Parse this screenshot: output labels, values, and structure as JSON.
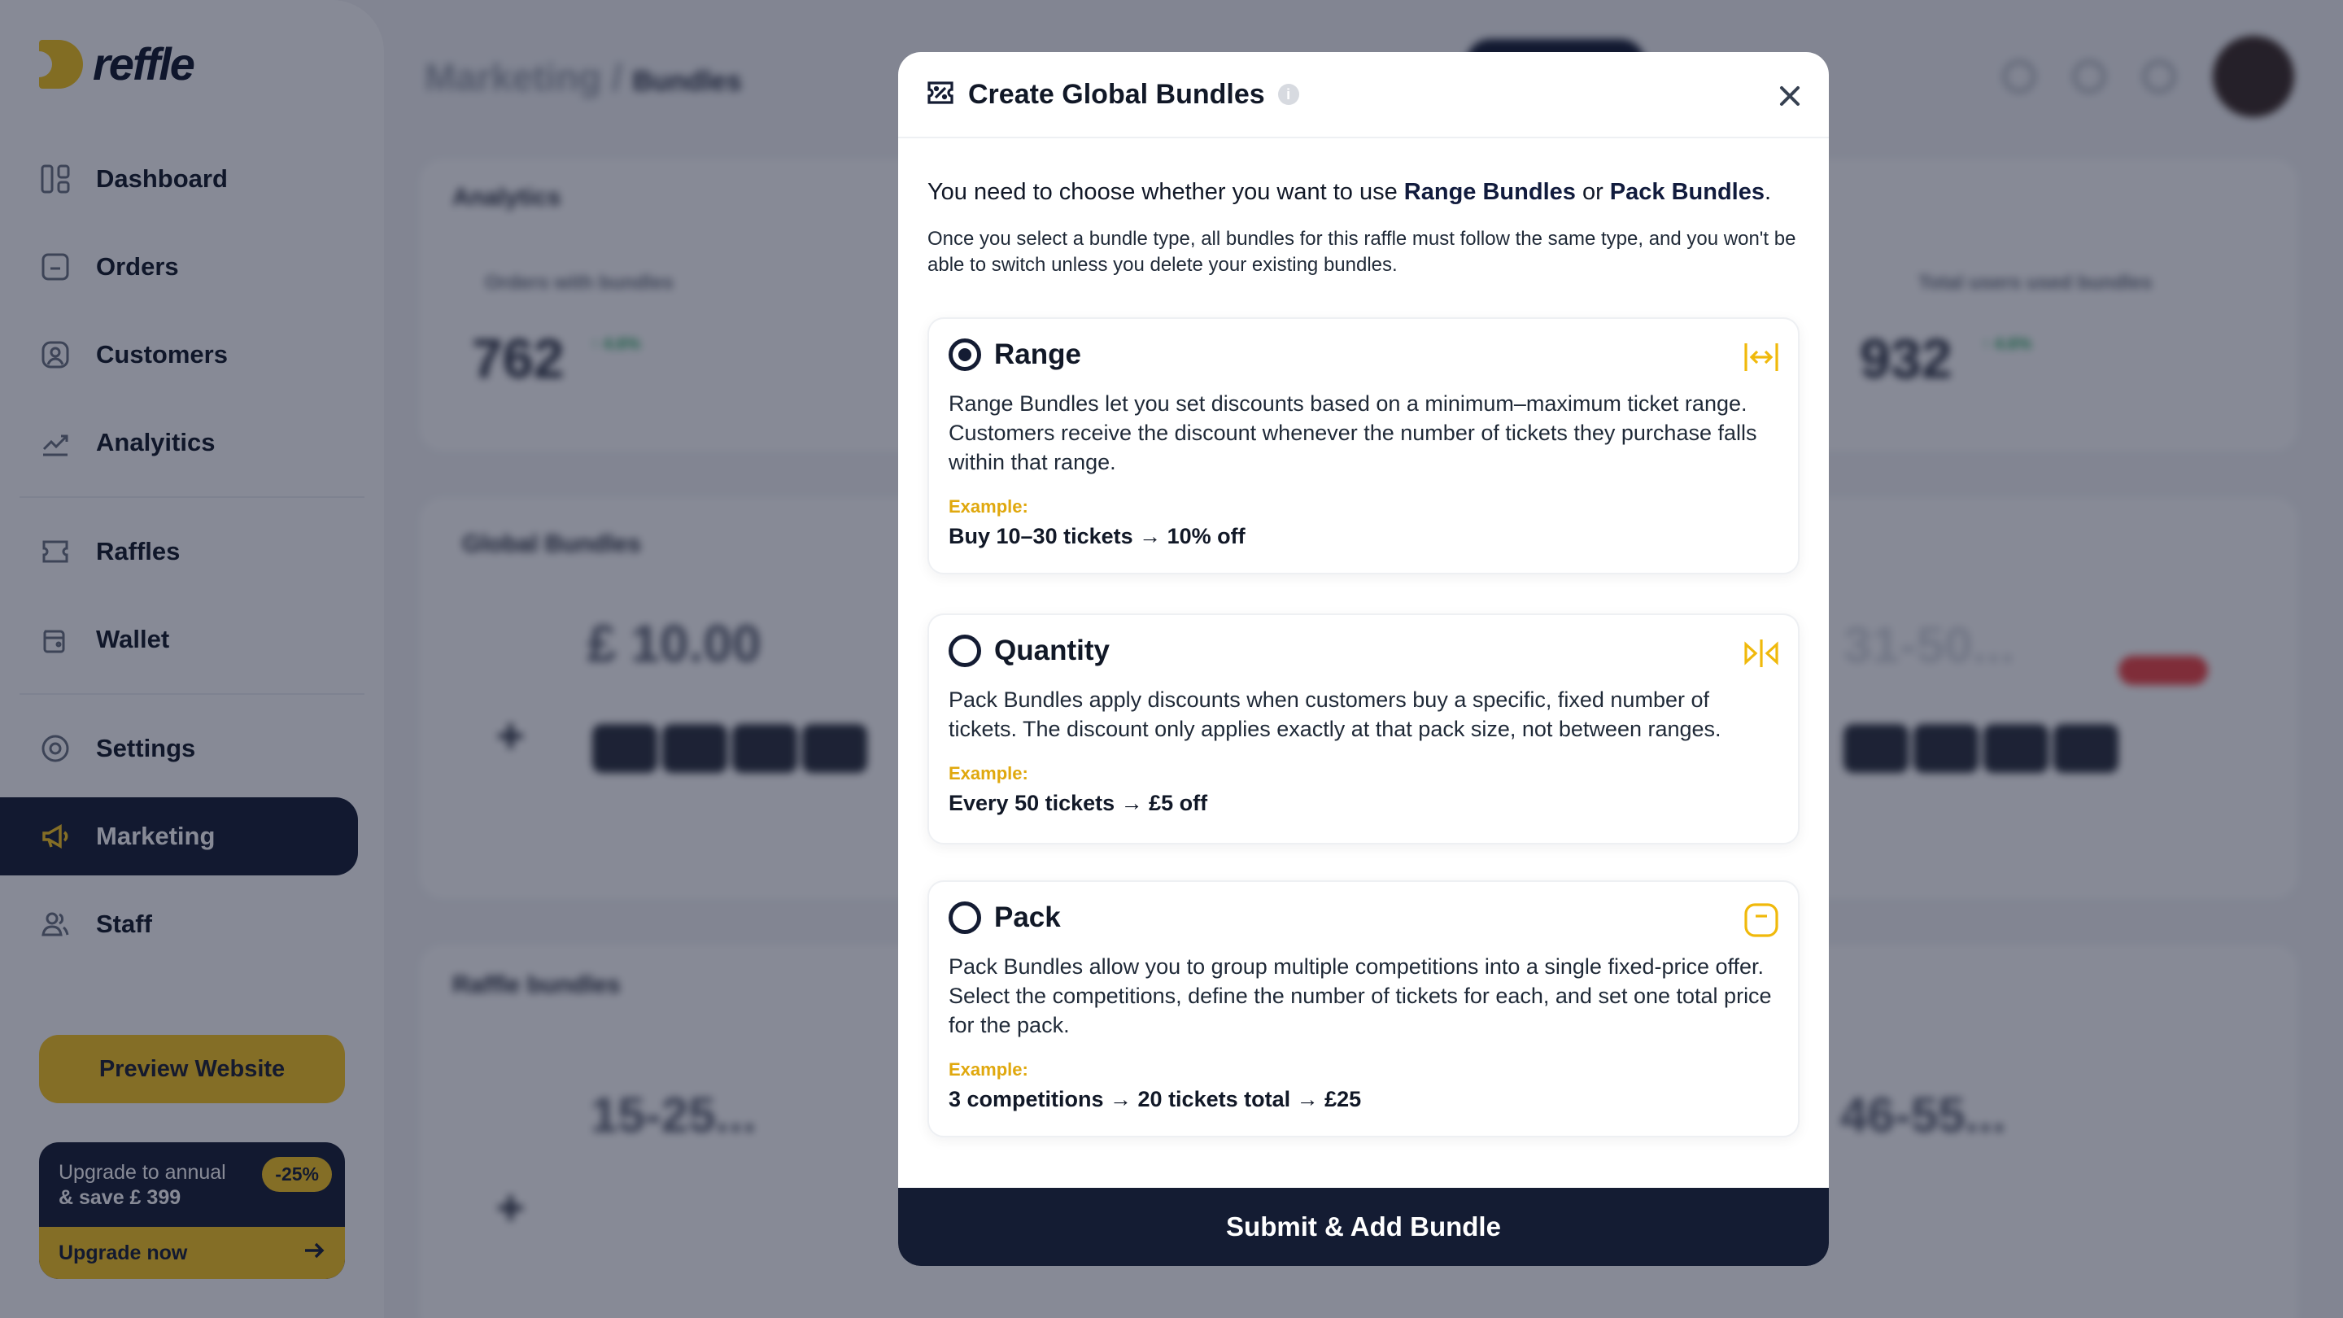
{
  "app": {
    "name": "reffle"
  },
  "sidebar": {
    "items": [
      {
        "label": "Dashboard",
        "icon": "dashboard-icon"
      },
      {
        "label": "Orders",
        "icon": "orders-icon"
      },
      {
        "label": "Customers",
        "icon": "customers-icon"
      },
      {
        "label": "Analyitics",
        "icon": "analytics-icon"
      },
      {
        "label": "Raffles",
        "icon": "ticket-icon"
      },
      {
        "label": "Wallet",
        "icon": "wallet-icon"
      },
      {
        "label": "Settings",
        "icon": "settings-icon"
      },
      {
        "label": "Marketing",
        "icon": "megaphone-icon",
        "active": true
      },
      {
        "label": "Staff",
        "icon": "staff-icon"
      }
    ],
    "preview_button": "Preview Website",
    "upgrade": {
      "line1": "Upgrade to annual",
      "line2": "& save £ 399",
      "badge": "-25%",
      "cta": "Upgrade now"
    }
  },
  "background": {
    "breadcrumb_parent": "Marketing /",
    "breadcrumb_current": "Bundles",
    "analytics_title": "Analytics",
    "stat_left": {
      "label": "Orders with bundles",
      "value": "762"
    },
    "stat_right": {
      "label": "Total users used bundles",
      "value": "932"
    },
    "global_bundles_title": "Global Bundles",
    "global_price": "£ 10.00",
    "range_text": "31-50...",
    "raffle_bundles_title": "Raffle bundles",
    "raffle_range_1": "15-25...",
    "raffle_range_2": "46-55..."
  },
  "modal": {
    "title": "Create Global Bundles",
    "info": "i",
    "intro_prefix": "You need to choose whether you want to use ",
    "intro_range": "Range Bundles",
    "intro_or": " or ",
    "intro_pack": "Pack Bundles",
    "intro_suffix": ".",
    "intro_sub": "Once you select a bundle type, all bundles for this raffle must follow the same type, and you won't be able to switch unless you delete your existing bundles.",
    "options": [
      {
        "title": "Range",
        "selected": true,
        "icon": "range-arrows-icon",
        "description": "Range Bundles let you set discounts based on a minimum–maximum ticket range. Customers receive the discount whenever the number of tickets they purchase falls within that range.",
        "example_label": "Example:",
        "example": "Buy 10–30 tickets → 10% off"
      },
      {
        "title": "Quantity",
        "selected": false,
        "icon": "quantity-arrows-icon",
        "description": "Pack Bundles apply discounts when customers buy a specific, fixed number of tickets. The discount only applies exactly at that pack size, not between ranges.",
        "example_label": "Example:",
        "example": "Every 50 tickets → £5 off"
      },
      {
        "title": "Pack",
        "selected": false,
        "icon": "pack-box-icon",
        "description": "Pack Bundles allow you to group multiple competitions into a single fixed-price offer. Select the competitions, define the number of tickets for each, and set one total price for the pack.",
        "example_label": "Example:",
        "example": "3 competitions → 20 tickets total → £25"
      }
    ],
    "submit": "Submit & Add Bundle"
  },
  "colors": {
    "navy": "#141c33",
    "yellow": "#f8c61e",
    "example_gold": "#e0a80e",
    "overlay": "rgba(15,22,45,0.5)"
  }
}
